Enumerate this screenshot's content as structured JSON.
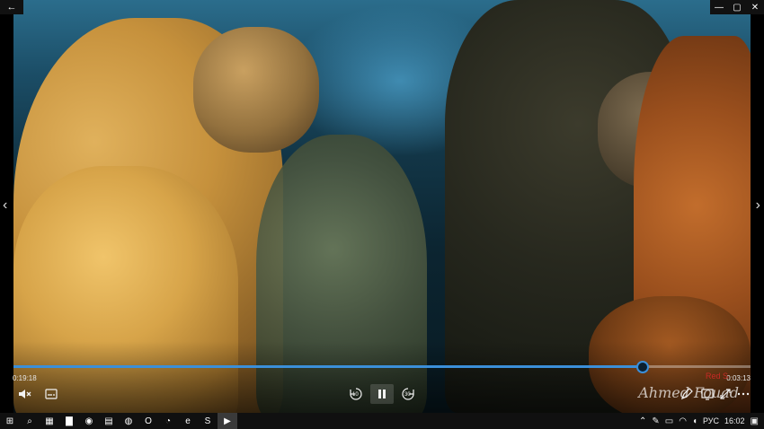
{
  "window": {
    "back_icon": "arrow-left-icon",
    "controls": {
      "minimize": "—",
      "maximize": "▢",
      "close": "✕"
    }
  },
  "player": {
    "elapsed": "0:19:18",
    "duration": "0:03:13",
    "progress_fraction": 0.854,
    "controls": {
      "volume_icon": "speaker-mute-icon",
      "subtitles_icon": "subtitles-icon",
      "rewind_label": "10",
      "pause_icon": "pause-icon",
      "forward_label": "30",
      "pen_icon": "pen-icon",
      "cast_icon": "cast-icon",
      "fullscreen_icon": "fullscreen-icon",
      "more_icon": "more-icon"
    },
    "watermark": "Ahmed Fouad",
    "watermark_small": "Red S"
  },
  "taskbar": {
    "apps": [
      {
        "name": "start-icon",
        "glyph": "⊞"
      },
      {
        "name": "search-icon",
        "glyph": "⌕"
      },
      {
        "name": "task-view-icon",
        "glyph": "▦"
      },
      {
        "name": "file-explorer-icon",
        "glyph": "▇"
      },
      {
        "name": "firefox-icon",
        "glyph": "◉"
      },
      {
        "name": "files-icon",
        "glyph": "▤"
      },
      {
        "name": "browser-icon",
        "glyph": "◍"
      },
      {
        "name": "opera-icon",
        "glyph": "O"
      },
      {
        "name": "chrome-icon",
        "glyph": "◔"
      },
      {
        "name": "edge-icon",
        "glyph": "e"
      },
      {
        "name": "skype-icon",
        "glyph": "S"
      },
      {
        "name": "media-player-icon",
        "glyph": "▶"
      }
    ],
    "tray": {
      "language": "РУС",
      "time": "16:02"
    },
    "colors": {
      "accent": "#3b8fd9",
      "taskbar_bg": "#101010"
    }
  }
}
